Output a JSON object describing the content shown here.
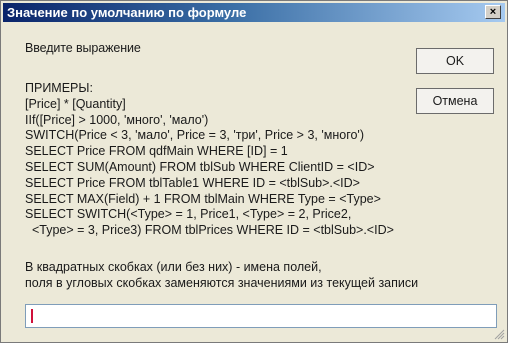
{
  "window": {
    "title": "Значение по умолчанию по формуле",
    "close_glyph": "×"
  },
  "prompt": "Введите выражение",
  "buttons": {
    "ok": "OK",
    "cancel": "Отмена"
  },
  "examples": {
    "heading": "ПРИМЕРЫ:",
    "lines": [
      "[Price] * [Quantity]",
      "IIf([Price] > 1000, 'много', 'мало')",
      "SWITCH(Price < 3, 'мало', Price = 3, 'три', Price > 3, 'много')",
      "SELECT Price FROM qdfMain WHERE [ID] = 1",
      "SELECT SUM(Amount) FROM tblSub WHERE ClientID = <ID>",
      "SELECT Price FROM tblTable1 WHERE ID = <tblSub>.<ID>",
      "SELECT MAX(Field) + 1 FROM tblMain WHERE Type = <Type>",
      "SELECT SWITCH(<Type> = 1, Price1, <Type> = 2, Price2,",
      "  <Type> = 3, Price3) FROM tblPrices WHERE ID = <tblSub>.<ID>"
    ]
  },
  "hint": {
    "line1": "В квадратных скобках (или без них) - имена полей,",
    "line2": "поля в угловых скобках заменяются значениями из текущей записи"
  },
  "expression_input": {
    "value": ""
  }
}
